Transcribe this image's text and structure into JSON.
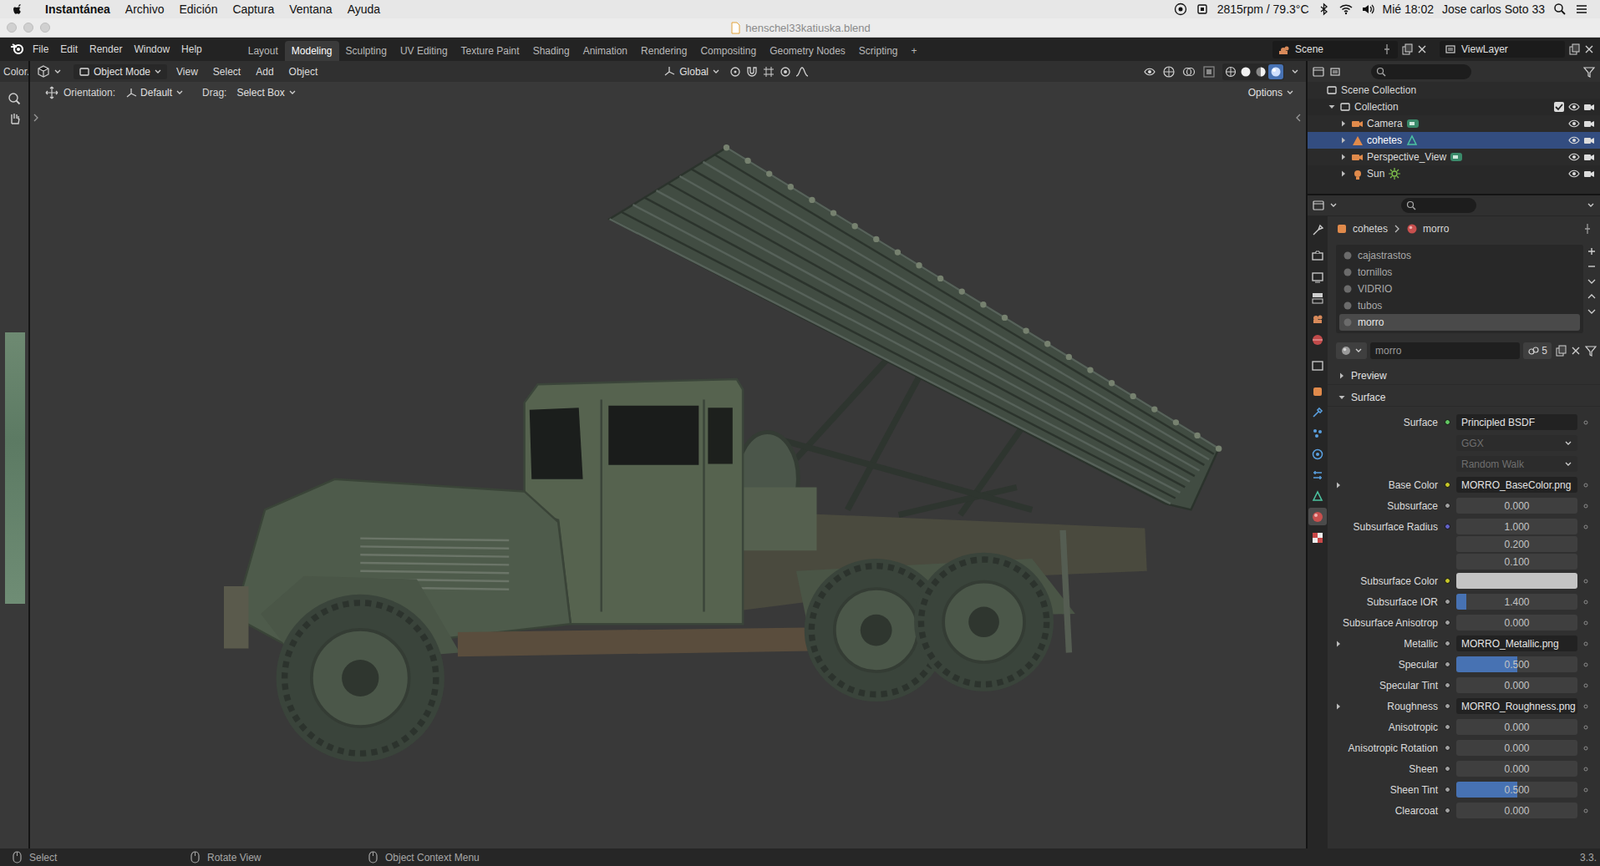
{
  "menubar": {
    "app": "Instantánea",
    "menus": [
      "Archivo",
      "Edición",
      "Captura",
      "Ventana",
      "Ayuda"
    ],
    "sensors": "2815rpm / 79.3°C",
    "clock": "Mié 18:02",
    "user": "Jose carlos Soto 33"
  },
  "window": {
    "title": "henschel33katiuska.blend"
  },
  "topbar": {
    "menus": [
      "File",
      "Edit",
      "Render",
      "Window",
      "Help"
    ],
    "workspaces": [
      {
        "label": "Layout",
        "selected": false
      },
      {
        "label": "Modeling",
        "selected": true
      },
      {
        "label": "Sculpting",
        "selected": false
      },
      {
        "label": "UV Editing",
        "selected": false
      },
      {
        "label": "Texture Paint",
        "selected": false
      },
      {
        "label": "Shading",
        "selected": false
      },
      {
        "label": "Animation",
        "selected": false
      },
      {
        "label": "Rendering",
        "selected": false
      },
      {
        "label": "Compositing",
        "selected": false
      },
      {
        "label": "Geometry Nodes",
        "selected": false
      },
      {
        "label": "Scripting",
        "selected": false
      }
    ],
    "add_workspace": "+",
    "scene": "Scene",
    "view_layer": "ViewLayer"
  },
  "side_editor": {
    "header": "Color."
  },
  "viewport": {
    "mode": "Object Mode",
    "menus": [
      "View",
      "Select",
      "Add",
      "Object"
    ],
    "transform_orientation": "Global",
    "shading_modes": [
      {
        "selected": false
      },
      {
        "selected": false
      },
      {
        "selected": false
      },
      {
        "selected": true
      }
    ]
  },
  "tool_settings": {
    "orientation_label": "Orientation:",
    "orientation": "Default",
    "drag_label": "Drag:",
    "drag": "Select Box",
    "options": "Options"
  },
  "outliner": {
    "root": "Scene Collection",
    "collection": {
      "name": "Collection",
      "checked": true,
      "visible": true,
      "children": [
        {
          "name": "Camera",
          "kind": "camera",
          "selected": false,
          "visible": true
        },
        {
          "name": "cohetes",
          "kind": "mesh",
          "selected": true,
          "visible": true
        },
        {
          "name": "Perspective_View",
          "kind": "camera",
          "selected": false,
          "visible": true
        },
        {
          "name": "Sun",
          "kind": "light",
          "selected": false,
          "visible": true
        }
      ]
    }
  },
  "properties": {
    "tabs": [
      {
        "selected": false
      },
      {
        "selected": false
      },
      {
        "selected": false
      },
      {
        "selected": false
      },
      {
        "selected": false
      },
      {
        "selected": false
      },
      {
        "selected": false
      },
      {
        "selected": false
      },
      {
        "selected": false
      },
      {
        "selected": false
      },
      {
        "selected": false
      },
      {
        "selected": false
      },
      {
        "selected": false
      },
      {
        "selected": true
      },
      {
        "selected": false
      }
    ],
    "breadcrumb": {
      "object": "cohetes",
      "material": "morro"
    },
    "slots": [
      {
        "name": "cajastrastos",
        "selected": false
      },
      {
        "name": "tornillos",
        "selected": false
      },
      {
        "name": "VIDRIO",
        "selected": false
      },
      {
        "name": "tubos",
        "selected": false
      },
      {
        "name": "morro",
        "selected": true
      }
    ],
    "material": {
      "name": "morro",
      "users": "5"
    },
    "panels": [
      {
        "label": "Preview",
        "expanded": false
      },
      {
        "label": "Surface",
        "expanded": true
      }
    ],
    "rows": [
      {
        "kind": "shader",
        "label": "Surface",
        "value": "Principled BSDF",
        "socket": "#63c763",
        "disabled": false
      },
      {
        "kind": "dropdown",
        "value": "GGX",
        "disabled": true
      },
      {
        "kind": "dropdown",
        "value": "Random Walk",
        "disabled": true
      },
      {
        "kind": "texture",
        "label": "Base Color",
        "value": "MORRO_BaseColor.png",
        "socket": "#c7c729",
        "disabled": false
      },
      {
        "kind": "slider",
        "label": "Subsurface",
        "value": "0.000",
        "level": 0,
        "socket": "#a1a1a1",
        "disabled": false
      },
      {
        "kind": "vector",
        "label": "Subsurface Radius",
        "values": [
          "1.000",
          "0.200",
          "0.100"
        ],
        "socket": "#6363c7",
        "disabled": false
      },
      {
        "kind": "color",
        "label": "Subsurface Color",
        "swatch": "#c4c4c4",
        "socket": "#c7c729",
        "disabled": false
      },
      {
        "kind": "slider",
        "label": "Subsurface IOR",
        "value": "1.400",
        "level": 0.08,
        "socket": "#a1a1a1",
        "disabled": false
      },
      {
        "kind": "slider",
        "label": "Subsurface Anisotrop",
        "value": "0.000",
        "level": 0,
        "socket": "#a1a1a1",
        "disabled": false
      },
      {
        "kind": "texture",
        "label": "Metallic",
        "value": "MORRO_Metallic.png",
        "socket": "#a1a1a1",
        "disabled": false
      },
      {
        "kind": "slider",
        "label": "Specular",
        "value": "0.500",
        "level": 0.5,
        "socket": "#a1a1a1",
        "disabled": false
      },
      {
        "kind": "slider",
        "label": "Specular Tint",
        "value": "0.000",
        "level": 0,
        "socket": "#a1a1a1",
        "disabled": false
      },
      {
        "kind": "texture",
        "label": "Roughness",
        "value": "MORRO_Roughness.png",
        "socket": "#a1a1a1",
        "disabled": false
      },
      {
        "kind": "slider",
        "label": "Anisotropic",
        "value": "0.000",
        "level": 0,
        "socket": "#a1a1a1",
        "disabled": false
      },
      {
        "kind": "slider",
        "label": "Anisotropic Rotation",
        "value": "0.000",
        "level": 0,
        "socket": "#a1a1a1",
        "disabled": false
      },
      {
        "kind": "slider",
        "label": "Sheen",
        "value": "0.000",
        "level": 0,
        "socket": "#a1a1a1",
        "disabled": false
      },
      {
        "kind": "slider",
        "label": "Sheen Tint",
        "value": "0.500",
        "level": 0.5,
        "socket": "#a1a1a1",
        "disabled": false
      },
      {
        "kind": "slider",
        "label": "Clearcoat",
        "value": "0.000",
        "level": 0,
        "socket": "#a1a1a1",
        "disabled": false
      }
    ]
  },
  "status_bar": {
    "hints": [
      "Select",
      "Rotate View",
      "Object Context Menu"
    ],
    "version": "3.3."
  }
}
